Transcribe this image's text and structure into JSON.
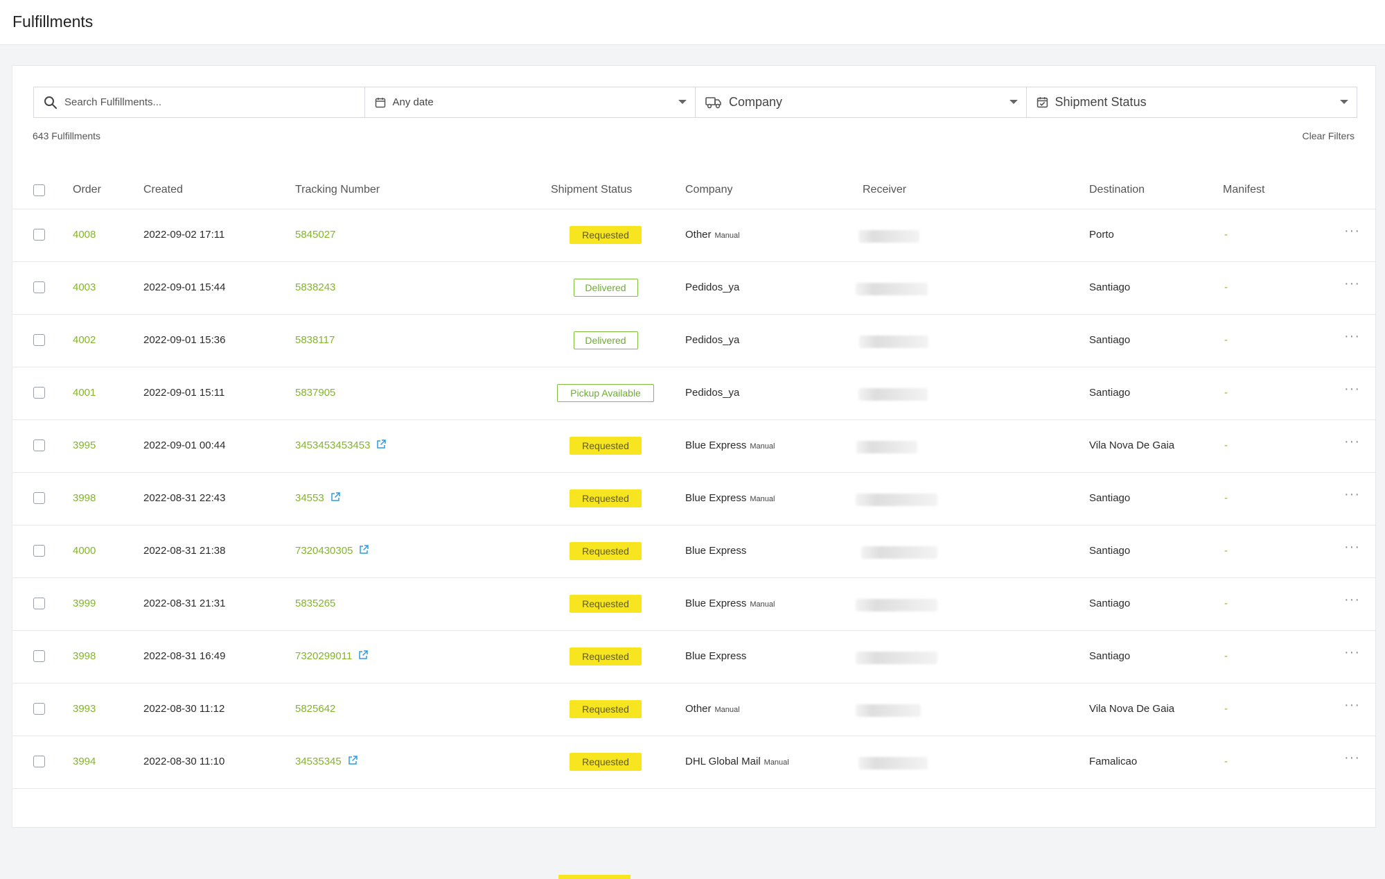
{
  "header": {
    "title": "Fulfillments"
  },
  "filters": {
    "search_placeholder": "Search Fulfillments...",
    "date_label": "Any date",
    "company_label": "Company",
    "status_label": "Shipment Status"
  },
  "summary": {
    "count_text": "643 Fulfillments",
    "clear_label": "Clear Filters"
  },
  "table": {
    "columns": [
      "Order",
      "Created",
      "Tracking Number",
      "Shipment Status",
      "Company",
      "Receiver",
      "Destination",
      "Manifest"
    ],
    "rows": [
      {
        "order": "4008",
        "created": "2022-09-02 17:11",
        "tracking": "5845027",
        "external": false,
        "status": "Requested",
        "status_style": "req",
        "company": "Other",
        "manual": "Manual",
        "destination": "Porto",
        "manifest": "-"
      },
      {
        "order": "4003",
        "created": "2022-09-01 15:44",
        "tracking": "5838243",
        "external": false,
        "status": "Delivered",
        "status_style": "out",
        "company": "Pedidos_ya",
        "manual": "",
        "destination": "Santiago",
        "manifest": "-"
      },
      {
        "order": "4002",
        "created": "2022-09-01 15:36",
        "tracking": "5838117",
        "external": false,
        "status": "Delivered",
        "status_style": "out",
        "company": "Pedidos_ya",
        "manual": "",
        "destination": "Santiago",
        "manifest": "-"
      },
      {
        "order": "4001",
        "created": "2022-09-01 15:11",
        "tracking": "5837905",
        "external": false,
        "status": "Pickup Available",
        "status_style": "out",
        "company": "Pedidos_ya",
        "manual": "",
        "destination": "Santiago",
        "manifest": "-"
      },
      {
        "order": "3995",
        "created": "2022-09-01 00:44",
        "tracking": "3453453453453",
        "external": true,
        "status": "Requested",
        "status_style": "req",
        "company": "Blue Express",
        "manual": "Manual",
        "destination": "Vila Nova De Gaia",
        "manifest": "-"
      },
      {
        "order": "3998",
        "created": "2022-08-31 22:43",
        "tracking": "34553",
        "external": true,
        "status": "Requested",
        "status_style": "req",
        "company": "Blue Express",
        "manual": "Manual",
        "destination": "Santiago",
        "manifest": "-"
      },
      {
        "order": "4000",
        "created": "2022-08-31 21:38",
        "tracking": "7320430305",
        "external": true,
        "status": "Requested",
        "status_style": "req",
        "company": "Blue Express",
        "manual": "",
        "destination": "Santiago",
        "manifest": "-"
      },
      {
        "order": "3999",
        "created": "2022-08-31 21:31",
        "tracking": "5835265",
        "external": false,
        "status": "Requested",
        "status_style": "req",
        "company": "Blue Express",
        "manual": "Manual",
        "destination": "Santiago",
        "manifest": "-"
      },
      {
        "order": "3998",
        "created": "2022-08-31 16:49",
        "tracking": "7320299011",
        "external": true,
        "status": "Requested",
        "status_style": "req",
        "company": "Blue Express",
        "manual": "",
        "destination": "Santiago",
        "manifest": "-"
      },
      {
        "order": "3993",
        "created": "2022-08-30 11:12",
        "tracking": "5825642",
        "external": false,
        "status": "Requested",
        "status_style": "req",
        "company": "Other",
        "manual": "Manual",
        "destination": "Vila Nova De Gaia",
        "manifest": "-"
      },
      {
        "order": "3994",
        "created": "2022-08-30 11:10",
        "tracking": "34535345",
        "external": true,
        "status": "Requested",
        "status_style": "req",
        "company": "DHL Global Mail",
        "manual": "Manual",
        "destination": "Famalicao",
        "manifest": "-"
      }
    ]
  },
  "icons": {
    "search": "search-icon",
    "calendar": "calendar-icon",
    "truck": "truck-icon",
    "status": "calendar-check-icon",
    "external": "external-link-icon",
    "more": "more-horizontal-icon"
  },
  "colors": {
    "accent_green": "#84b52b",
    "badge_yellow": "#f7e520",
    "badge_outline": "#7bbf3a"
  }
}
